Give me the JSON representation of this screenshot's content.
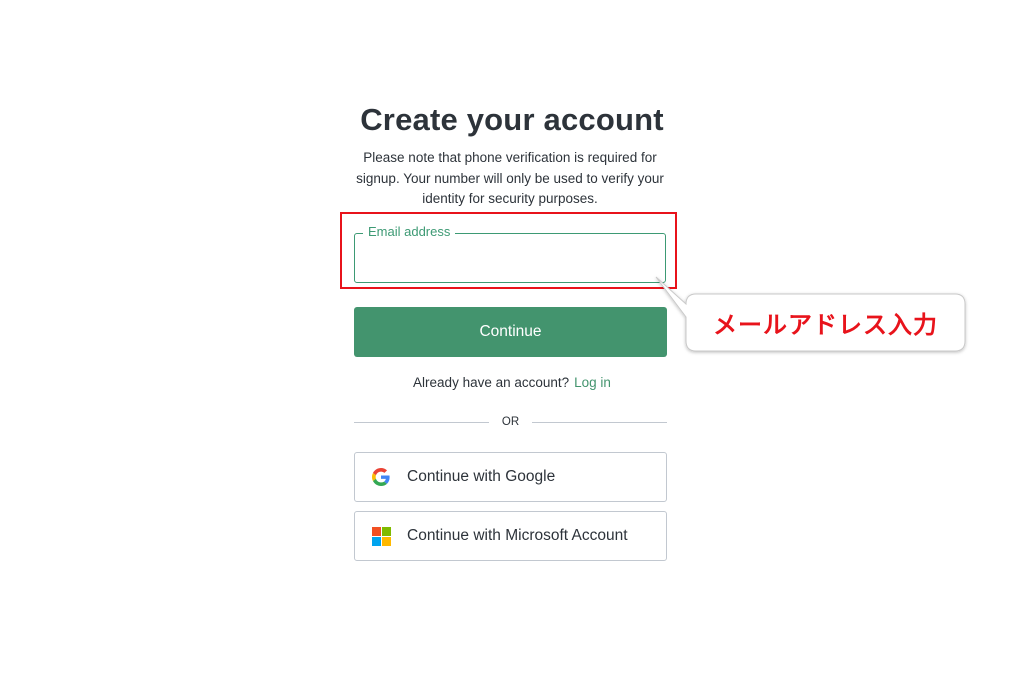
{
  "page": {
    "title": "Create your account",
    "subtitle": "Please note that phone verification is required for signup. Your number will only be used to verify your identity for security purposes."
  },
  "form": {
    "email_label": "Email address",
    "email_value": "",
    "continue_label": "Continue",
    "accent_color": "#43946e"
  },
  "login_prompt": {
    "text": "Already have an account?",
    "link": "Log in"
  },
  "divider": {
    "text": "OR"
  },
  "social": [
    {
      "label": "Continue with Google",
      "icon": "google-icon"
    },
    {
      "label": "Continue with Microsoft Account",
      "icon": "microsoft-icon"
    }
  ],
  "annotation": {
    "callout_text": "メールアドレス入力",
    "highlight_color": "#e8131b"
  }
}
